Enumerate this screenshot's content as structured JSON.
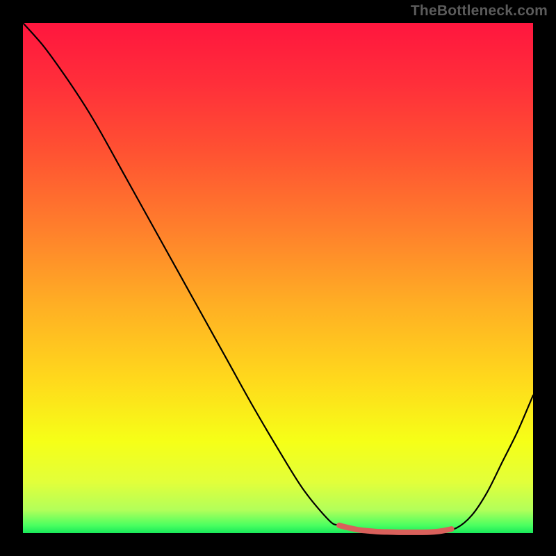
{
  "watermark": "TheBottleneck.com",
  "plot": {
    "inner_x": 33,
    "inner_y": 33,
    "inner_w": 734,
    "inner_h": 734
  },
  "gradient_stops": [
    {
      "offset": 0.0,
      "color": "#ff163e"
    },
    {
      "offset": 0.12,
      "color": "#ff2f3a"
    },
    {
      "offset": 0.25,
      "color": "#ff5132"
    },
    {
      "offset": 0.4,
      "color": "#ff7e2c"
    },
    {
      "offset": 0.55,
      "color": "#ffae24"
    },
    {
      "offset": 0.7,
      "color": "#ffd91c"
    },
    {
      "offset": 0.82,
      "color": "#f6ff17"
    },
    {
      "offset": 0.9,
      "color": "#e2ff3a"
    },
    {
      "offset": 0.955,
      "color": "#b2ff5a"
    },
    {
      "offset": 0.985,
      "color": "#4aff60"
    },
    {
      "offset": 1.0,
      "color": "#18e85a"
    }
  ],
  "chart_data": {
    "type": "line",
    "title": "",
    "xlabel": "",
    "ylabel": "",
    "xlim": [
      0,
      100
    ],
    "ylim": [
      0,
      100
    ],
    "series": [
      {
        "name": "main-curve",
        "color": "#000000",
        "x": [
          0,
          4,
          8,
          12,
          15,
          20,
          25,
          30,
          35,
          40,
          45,
          50,
          55,
          60,
          62,
          65,
          68,
          71,
          74,
          77,
          80,
          82,
          85,
          88,
          91,
          94,
          97,
          100
        ],
        "y": [
          100,
          95.5,
          90,
          84,
          79,
          70,
          61,
          52,
          43,
          34,
          25,
          16.5,
          8.5,
          2.5,
          1.5,
          0.8,
          0.4,
          0.2,
          0.15,
          0.15,
          0.2,
          0.4,
          1.0,
          3.5,
          8,
          14,
          20,
          27
        ]
      },
      {
        "name": "highlight-band",
        "color": "#d9605b",
        "x": [
          62,
          64,
          66,
          68,
          70,
          72,
          74,
          76,
          78,
          80,
          82,
          84
        ],
        "y": [
          1.5,
          1.0,
          0.6,
          0.4,
          0.25,
          0.2,
          0.15,
          0.15,
          0.15,
          0.2,
          0.4,
          0.8
        ]
      }
    ]
  }
}
